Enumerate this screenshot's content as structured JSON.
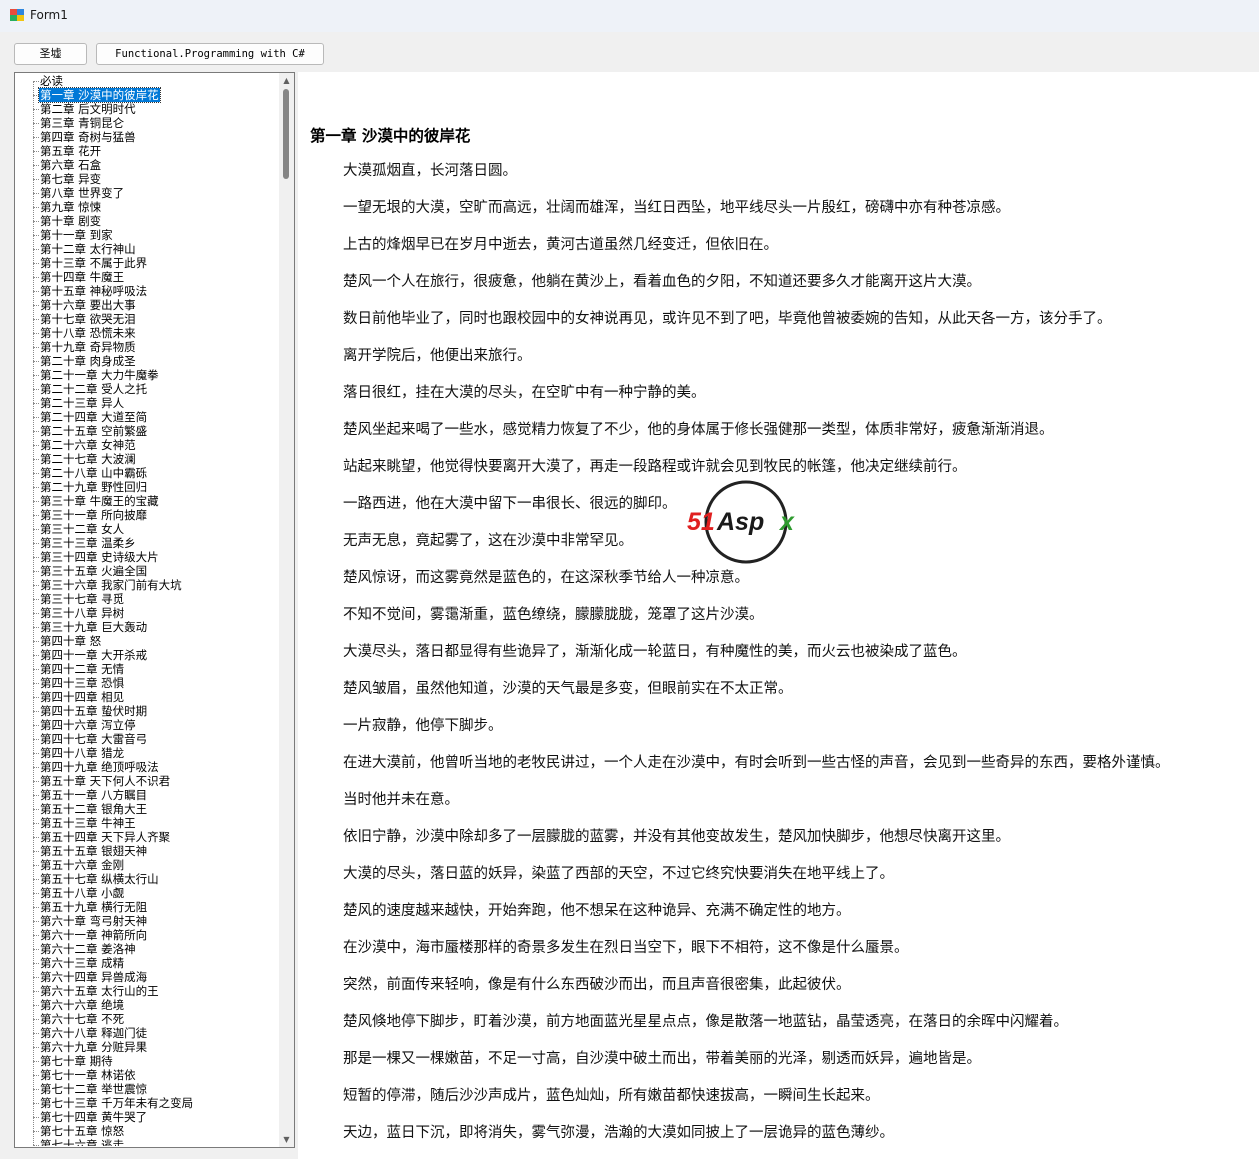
{
  "window": {
    "title": "Form1"
  },
  "toolbar": {
    "button1_label": "圣墟",
    "button2_label": "Functional.Programming with C#"
  },
  "tree": {
    "items": [
      "必读",
      "第一章 沙漠中的彼岸花",
      "第二章 后文明时代",
      "第三章 青铜昆仑",
      "第四章 奇树与猛兽",
      "第五章 花开",
      "第六章 石盒",
      "第七章 异变",
      "第八章 世界变了",
      "第九章 惊悚",
      "第十章 剧变",
      "第十一章 到家",
      "第十二章 太行神山",
      "第十三章 不属于此界",
      "第十四章 牛魔王",
      "第十五章 神秘呼吸法",
      "第十六章 要出大事",
      "第十七章 欲哭无泪",
      "第十八章 恐慌未来",
      "第十九章 奇异物质",
      "第二十章 肉身成圣",
      "第二十一章 大力牛魔拳",
      "第二十二章 受人之托",
      "第二十三章 异人",
      "第二十四章 大道至简",
      "第二十五章 空前繁盛",
      "第二十六章 女神范",
      "第二十七章 大波澜",
      "第二十八章 山中霸砾",
      "第二十九章 野性回归",
      "第三十章 牛魔王的宝藏",
      "第三十一章 所向披靡",
      "第三十二章 女人",
      "第三十三章 温柔乡",
      "第三十四章 史诗级大片",
      "第三十五章 火遍全国",
      "第三十六章 我家门前有大坑",
      "第三十七章 寻觅",
      "第三十八章 异树",
      "第三十九章 巨大轰动",
      "第四十章 怒",
      "第四十一章 大开杀戒",
      "第四十二章 无情",
      "第四十三章 恐惧",
      "第四十四章 相见",
      "第四十五章 蛰伏时期",
      "第四十六章 泻立停",
      "第四十七章 大雷音弓",
      "第四十八章 猎龙",
      "第四十九章 绝顶呼吸法",
      "第五十章 天下何人不识君",
      "第五十一章 八方瞩目",
      "第五十二章 银角大王",
      "第五十三章 牛神王",
      "第五十四章 天下异人齐聚",
      "第五十五章 银翅天神",
      "第五十六章 金刚",
      "第五十七章 纵横太行山",
      "第五十八章 小觑",
      "第五十九章 横行无阻",
      "第六十章 弯弓射天神",
      "第六十一章 神箭所向",
      "第六十二章 姜洛神",
      "第六十三章 成精",
      "第六十四章 异兽成海",
      "第六十五章 太行山的王",
      "第六十六章 绝境",
      "第六十七章 不死",
      "第六十八章 释迦门徒",
      "第六十九章 分赃异果",
      "第七十章 期待",
      "第七十一章 林诺依",
      "第七十二章 举世震惊",
      "第七十三章 千万年未有之变局",
      "第七十四章 黄牛哭了",
      "第七十五章 惊怒",
      "第七十六章 逃走"
    ],
    "selected_index": 1
  },
  "content": {
    "chapter_title": "第一章 沙漠中的彼岸花",
    "paragraphs": [
      "大漠孤烟直，长河落日圆。",
      "一望无垠的大漠，空旷而高远，壮阔而雄浑，当红日西坠，地平线尽头一片殷红，磅礴中亦有种苍凉感。",
      "上古的烽烟早已在岁月中逝去，黄河古道虽然几经变迁，但依旧在。",
      "楚风一个人在旅行，很疲惫，他躺在黄沙上，看着血色的夕阳，不知道还要多久才能离开这片大漠。",
      "数日前他毕业了，同时也跟校园中的女神说再见，或许见不到了吧，毕竟他曾被委婉的告知，从此天各一方，该分手了。",
      "离开学院后，他便出来旅行。",
      "落日很红，挂在大漠的尽头，在空旷中有一种宁静的美。",
      "楚风坐起来喝了一些水，感觉精力恢复了不少，他的身体属于修长强健那一类型，体质非常好，疲惫渐渐消退。",
      "站起来眺望，他觉得快要离开大漠了，再走一段路程或许就会见到牧民的帐篷，他决定继续前行。",
      "一路西进，他在大漠中留下一串很长、很远的脚印。",
      "无声无息，竟起雾了，这在沙漠中非常罕见。",
      "楚风惊讶，而这雾竟然是蓝色的，在这深秋季节给人一种凉意。",
      "不知不觉间，雾霭渐重，蓝色缭绕，朦朦胧胧，笼罩了这片沙漠。",
      "大漠尽头，落日都显得有些诡异了，渐渐化成一轮蓝日，有种魔性的美，而火云也被染成了蓝色。",
      "楚风皱眉，虽然他知道，沙漠的天气最是多变，但眼前实在不太正常。",
      "一片寂静，他停下脚步。",
      "在进大漠前，他曾听当地的老牧民讲过，一个人走在沙漠中，有时会听到一些古怪的声音，会见到一些奇异的东西，要格外谨慎。",
      "当时他并未在意。",
      "依旧宁静，沙漠中除却多了一层朦胧的蓝雾，并没有其他变故发生，楚风加快脚步，他想尽快离开这里。",
      "大漠的尽头，落日蓝的妖异，染蓝了西部的天空，不过它终究快要消失在地平线上了。",
      "楚风的速度越来越快，开始奔跑，他不想呆在这种诡异、充满不确定性的地方。",
      "在沙漠中，海市蜃楼那样的奇景多发生在烈日当空下，眼下不相符，这不像是什么蜃景。",
      "突然，前面传来轻响，像是有什么东西破沙而出，而且声音很密集，此起彼伏。",
      "楚风倏地停下脚步，盯着沙漠，前方地面蓝光星星点点，像是散落一地蓝钻，晶莹透亮，在落日的余晖中闪耀着。",
      "那是一棵又一棵嫩苗，不足一寸高，自沙漠中破土而出，带着美丽的光泽，剔透而妖异，遍地皆是。",
      "短暂的停滞，随后沙沙声成片，蓝色灿灿，所有嫩苗都快速拔高，一瞬间生长起来。",
      "天边，蓝日下沉，即将消失，雾气弥漫，浩瀚的大漠如同披上了一层诡异的蓝色薄纱。"
    ]
  },
  "watermark": {
    "text": "51Aspx"
  }
}
